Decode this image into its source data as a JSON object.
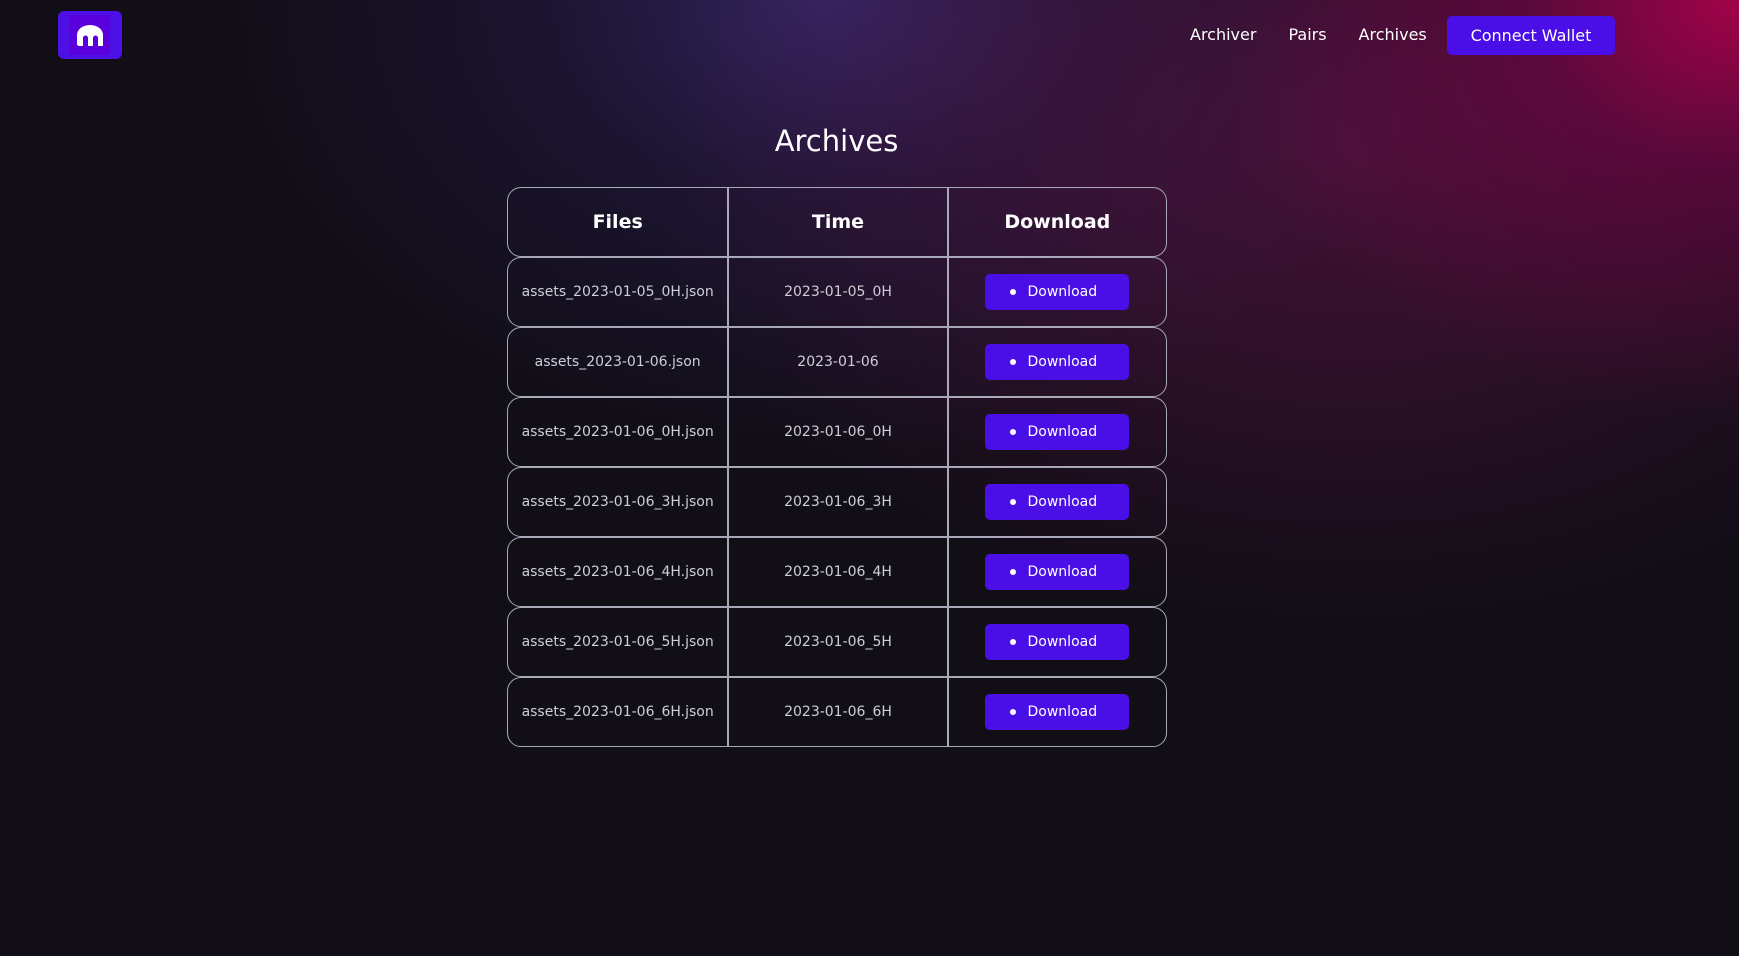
{
  "header": {
    "logo_icon": "kraken-logo-icon",
    "nav": [
      {
        "label": "Archiver"
      },
      {
        "label": "Pairs"
      },
      {
        "label": "Archives"
      }
    ],
    "connect_label": "Connect Wallet"
  },
  "main": {
    "title": "Archives",
    "table": {
      "columns": [
        "Files",
        "Time",
        "Download"
      ],
      "rows": [
        {
          "file": "assets_2023-01-05_0H.json",
          "time": "2023-01-05_0H",
          "action": "Download"
        },
        {
          "file": "assets_2023-01-06.json",
          "time": "2023-01-06",
          "action": "Download"
        },
        {
          "file": "assets_2023-01-06_0H.json",
          "time": "2023-01-06_0H",
          "action": "Download"
        },
        {
          "file": "assets_2023-01-06_3H.json",
          "time": "2023-01-06_3H",
          "action": "Download"
        },
        {
          "file": "assets_2023-01-06_4H.json",
          "time": "2023-01-06_4H",
          "action": "Download"
        },
        {
          "file": "assets_2023-01-06_5H.json",
          "time": "2023-01-06_5H",
          "action": "Download"
        },
        {
          "file": "assets_2023-01-06_6H.json",
          "time": "2023-01-06_6H",
          "action": "Download"
        }
      ]
    }
  },
  "colors": {
    "accent": "#4a0fe6",
    "background": "#110e16",
    "border": "#a9a8b8",
    "glow_magenta": "#b90050",
    "glow_indigo": "#37286e"
  }
}
